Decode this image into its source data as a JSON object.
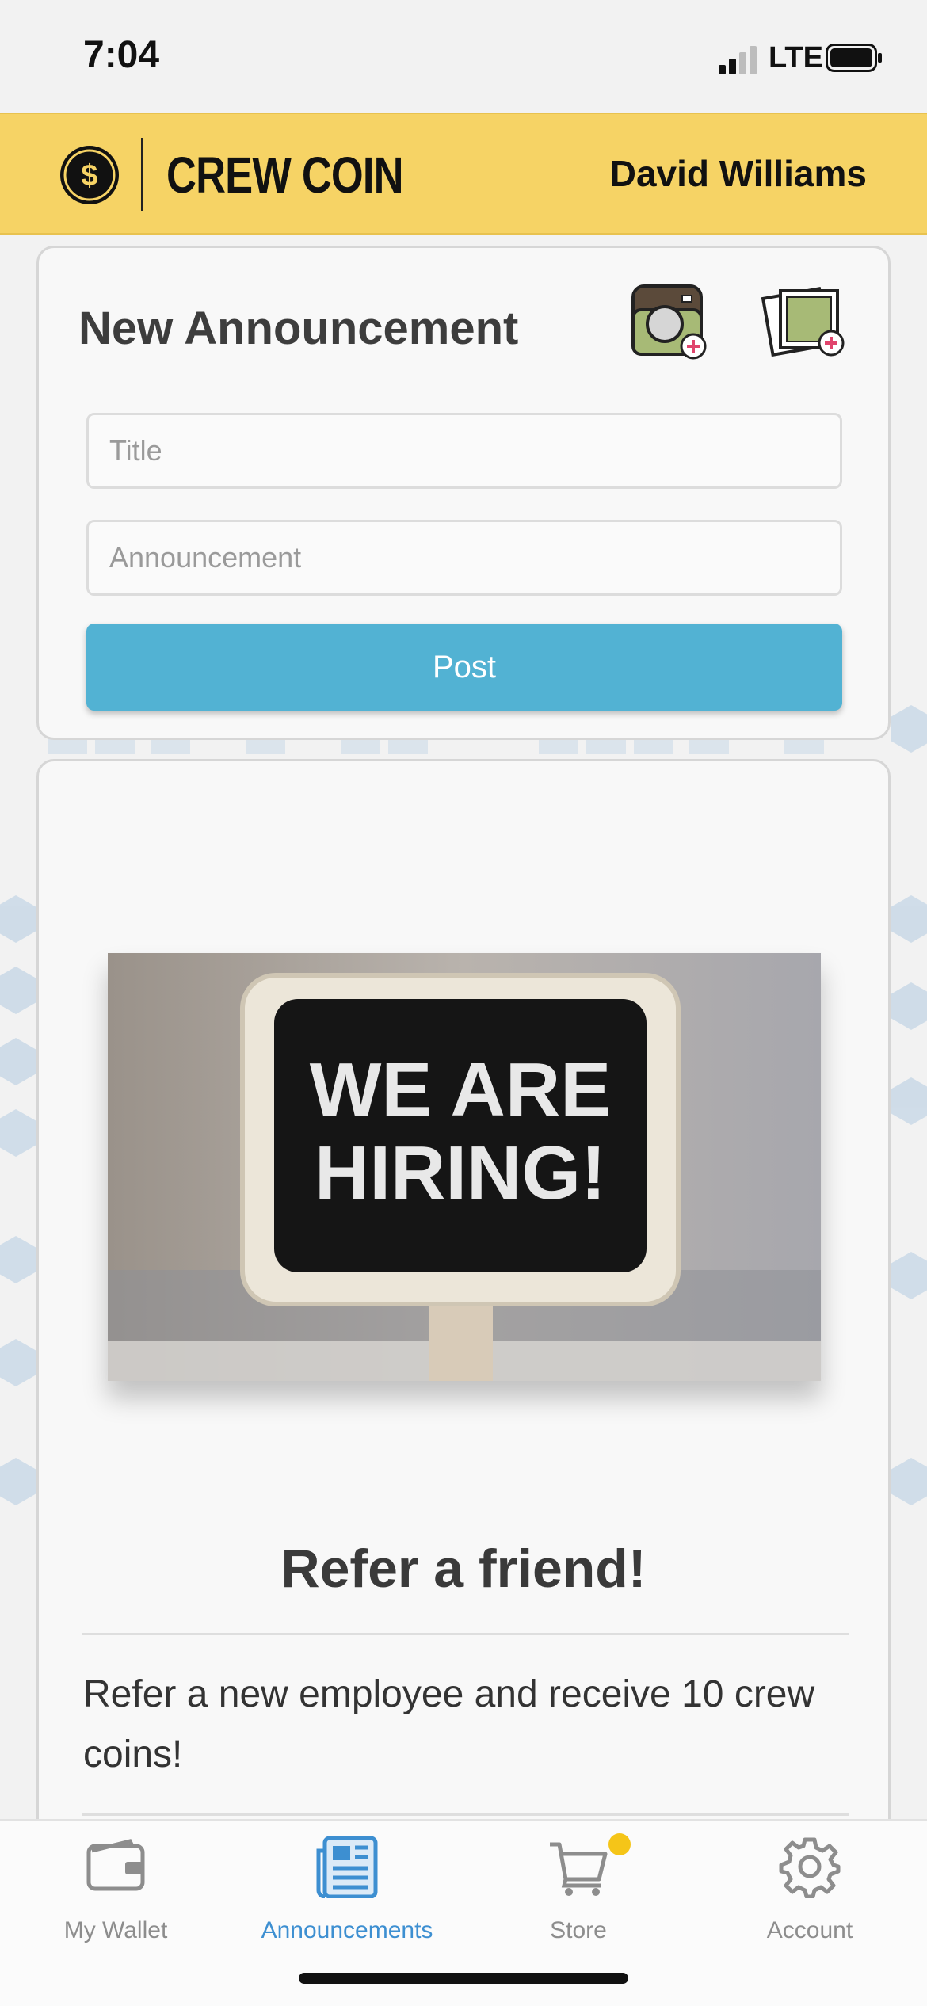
{
  "status_bar": {
    "time": "7:04",
    "network": "LTE"
  },
  "header": {
    "brand": "CREW COIN",
    "user_name": "David Williams"
  },
  "compose": {
    "title": "New Announcement",
    "title_placeholder": "Title",
    "announcement_placeholder": "Announcement",
    "post_label": "Post"
  },
  "announcement": {
    "image_text_line1": "WE ARE",
    "image_text_line2": "HIRING!",
    "title": "Refer a friend!",
    "body": "Refer a new employee and receive 10 crew coins!"
  },
  "tabs": [
    {
      "label": "My Wallet",
      "icon": "wallet-icon",
      "active": false
    },
    {
      "label": "Announcements",
      "icon": "newspaper-icon",
      "active": true
    },
    {
      "label": "Store",
      "icon": "cart-icon",
      "active": false
    },
    {
      "label": "Account",
      "icon": "gear-icon",
      "active": false
    }
  ],
  "colors": {
    "header": "#f6d365",
    "post_button": "#52b2d3",
    "active_tab": "#3d8fd1",
    "badge": "#f5c518"
  }
}
